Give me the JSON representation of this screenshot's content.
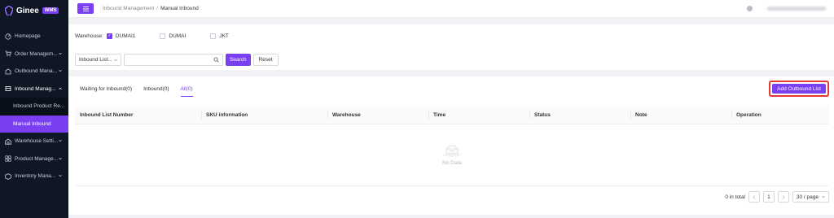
{
  "brand": {
    "name": "Ginee",
    "badge": "WMS"
  },
  "sidebar": {
    "items": [
      {
        "label": "Homepage",
        "icon": "dashboard-icon"
      },
      {
        "label": "Order Managem...",
        "icon": "cart-icon"
      },
      {
        "label": "Outbound Mana...",
        "icon": "outbound-icon"
      },
      {
        "label": "Inbound Manag...",
        "icon": "inbound-icon"
      },
      {
        "label": "Warehouse Setti...",
        "icon": "warehouse-icon"
      },
      {
        "label": "Product Manage...",
        "icon": "product-icon"
      },
      {
        "label": "Inventory Mana...",
        "icon": "inventory-icon"
      }
    ],
    "sub_items": [
      {
        "label": "Inbound Product Re..."
      },
      {
        "label": "Manual Inbound"
      }
    ]
  },
  "header": {
    "breadcrumb": [
      "Inbound Management",
      "Manual Inbound"
    ],
    "separator": "/"
  },
  "filter": {
    "warehouse_label": "Warehouse:",
    "warehouses": [
      {
        "label": "DUMAI1",
        "checked": true
      },
      {
        "label": "DUMAI",
        "checked": false
      },
      {
        "label": "JKT",
        "checked": false
      }
    ],
    "select_value": "Inbound List...",
    "search_placeholder": "",
    "search_button": "Search",
    "reset_button": "Reset"
  },
  "main": {
    "tabs": [
      {
        "label": "Waiting for Inbound(0)",
        "active": false
      },
      {
        "label": "Inbound(0)",
        "active": false
      },
      {
        "label": "All(0)",
        "active": true
      }
    ],
    "add_button": "Add Outbound List",
    "columns": [
      "Inbound List Number",
      "SKU information",
      "Warehouse",
      "Time",
      "Status",
      "Note",
      "Operation"
    ],
    "empty_text": "No Data"
  },
  "pagination": {
    "total_text": "0 in total",
    "current_page": "1",
    "page_size": "30 / page"
  },
  "colors": {
    "accent": "#7b3ff2",
    "sidebar_bg": "#0f1624",
    "highlight_border": "#e53935"
  }
}
